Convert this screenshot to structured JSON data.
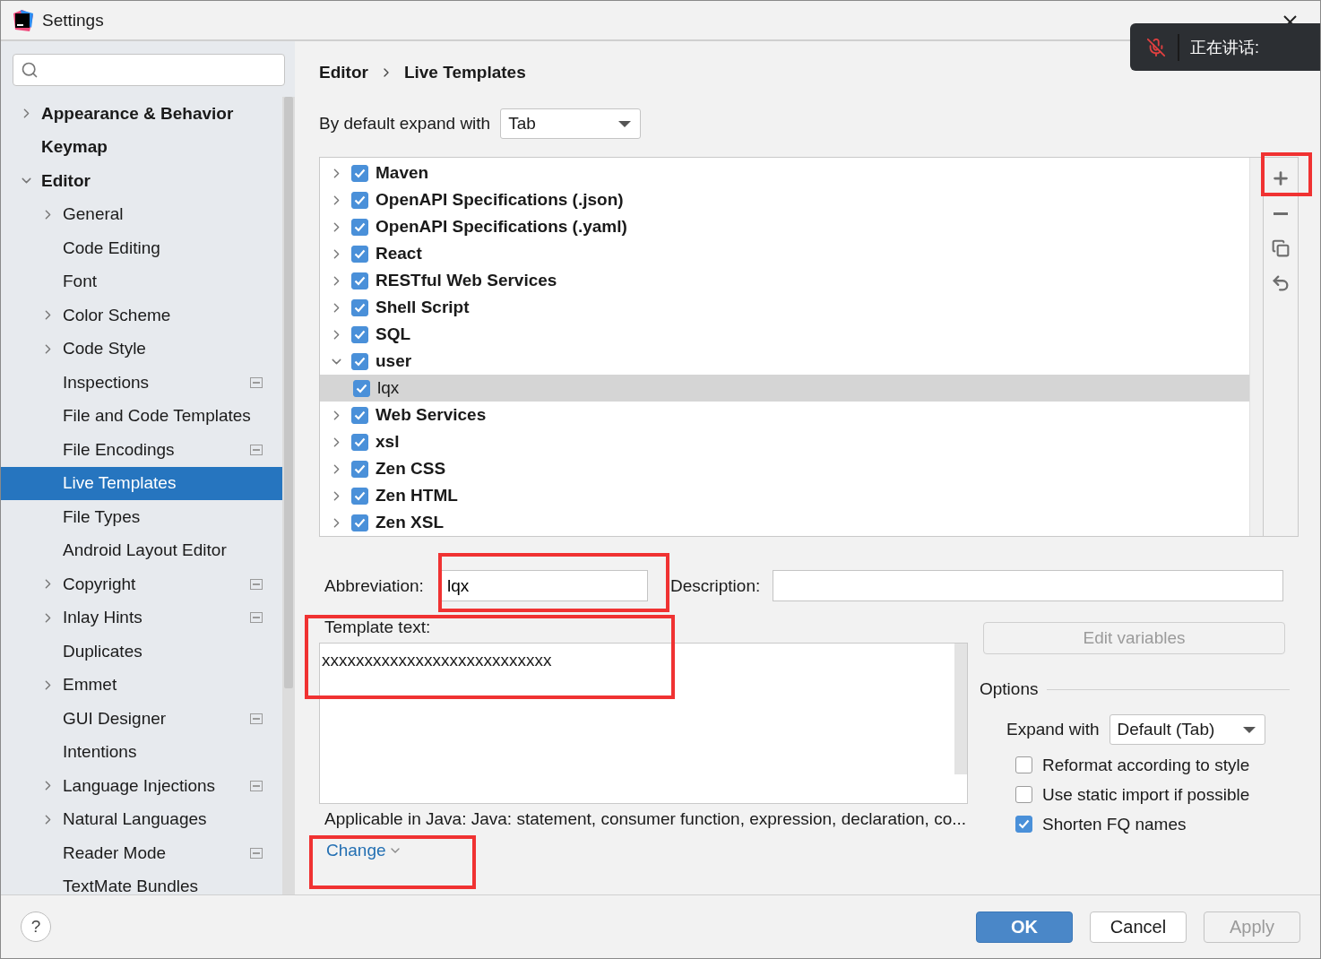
{
  "window": {
    "title": "Settings"
  },
  "sidebar": {
    "items": [
      {
        "label": "Appearance & Behavior",
        "expanded": false,
        "selected": false,
        "scoped": false
      },
      {
        "label": "Keymap",
        "selected": false,
        "scoped": false
      },
      {
        "label": "Editor",
        "expanded": true,
        "selected": false,
        "scoped": false,
        "children": [
          {
            "label": "General",
            "expanded": false,
            "selected": false,
            "scoped": false
          },
          {
            "label": "Code Editing",
            "selected": false,
            "scoped": false
          },
          {
            "label": "Font",
            "selected": false,
            "scoped": false
          },
          {
            "label": "Color Scheme",
            "expanded": false,
            "selected": false,
            "scoped": false
          },
          {
            "label": "Code Style",
            "expanded": false,
            "selected": false,
            "scoped": false
          },
          {
            "label": "Inspections",
            "selected": false,
            "scoped": true
          },
          {
            "label": "File and Code Templates",
            "selected": false,
            "scoped": false
          },
          {
            "label": "File Encodings",
            "selected": false,
            "scoped": true
          },
          {
            "label": "Live Templates",
            "selected": true,
            "scoped": false
          },
          {
            "label": "File Types",
            "selected": false,
            "scoped": false
          },
          {
            "label": "Android Layout Editor",
            "selected": false,
            "scoped": false
          },
          {
            "label": "Copyright",
            "expanded": false,
            "selected": false,
            "scoped": true
          },
          {
            "label": "Inlay Hints",
            "expanded": false,
            "selected": false,
            "scoped": true
          },
          {
            "label": "Duplicates",
            "selected": false,
            "scoped": false
          },
          {
            "label": "Emmet",
            "expanded": false,
            "selected": false,
            "scoped": false
          },
          {
            "label": "GUI Designer",
            "selected": false,
            "scoped": true
          },
          {
            "label": "Intentions",
            "selected": false,
            "scoped": false
          },
          {
            "label": "Language Injections",
            "expanded": false,
            "selected": false,
            "scoped": true
          },
          {
            "label": "Natural Languages",
            "expanded": false,
            "selected": false,
            "scoped": false
          },
          {
            "label": "Reader Mode",
            "selected": false,
            "scoped": true
          },
          {
            "label": "TextMate Bundles",
            "selected": false,
            "scoped": false
          }
        ]
      }
    ]
  },
  "breadcrumb": [
    "Editor",
    "Live Templates"
  ],
  "expand_default": {
    "label": "By default expand with",
    "value": "Tab"
  },
  "template_groups": [
    {
      "label": "Maven",
      "checked": true,
      "expanded": false,
      "selected": false
    },
    {
      "label": "OpenAPI Specifications (.json)",
      "checked": true,
      "expanded": false,
      "selected": false
    },
    {
      "label": "OpenAPI Specifications (.yaml)",
      "checked": true,
      "expanded": false,
      "selected": false
    },
    {
      "label": "React",
      "checked": true,
      "expanded": false,
      "selected": false
    },
    {
      "label": "RESTful Web Services",
      "checked": true,
      "expanded": false,
      "selected": false
    },
    {
      "label": "Shell Script",
      "checked": true,
      "expanded": false,
      "selected": false
    },
    {
      "label": "SQL",
      "checked": true,
      "expanded": false,
      "selected": false
    },
    {
      "label": "user",
      "checked": true,
      "expanded": true,
      "selected": false,
      "children": [
        {
          "label": "lqx",
          "checked": true,
          "selected": true
        }
      ]
    },
    {
      "label": "Web Services",
      "checked": true,
      "expanded": false,
      "selected": false
    },
    {
      "label": "xsl",
      "checked": true,
      "expanded": false,
      "selected": false
    },
    {
      "label": "Zen CSS",
      "checked": true,
      "expanded": false,
      "selected": false
    },
    {
      "label": "Zen HTML",
      "checked": true,
      "expanded": false,
      "selected": false
    },
    {
      "label": "Zen XSL",
      "checked": true,
      "expanded": false,
      "selected": false
    }
  ],
  "abbreviation": {
    "label": "Abbreviation:",
    "value": "lqx"
  },
  "description": {
    "label": "Description:"
  },
  "template_text": {
    "label": "Template text:",
    "value": "xxxxxxxxxxxxxxxxxxxxxxxxxxx"
  },
  "edit_variables": {
    "label": "Edit variables",
    "disabled": true
  },
  "options": {
    "title": "Options",
    "expand_with": {
      "label": "Expand with",
      "value": "Default (Tab)"
    },
    "checkboxes": [
      {
        "label": "Reformat according to style",
        "checked": false
      },
      {
        "label": "Use static import if possible",
        "checked": false
      },
      {
        "label": "Shorten FQ names",
        "checked": true
      }
    ]
  },
  "applicable": "Applicable in Java: Java: statement, consumer function, expression, declaration, co...",
  "change_link": "Change",
  "help": "?",
  "buttons": [
    {
      "label": "OK",
      "kind": "primary",
      "disabled": false
    },
    {
      "label": "Cancel",
      "kind": "default",
      "disabled": false
    },
    {
      "label": "Apply",
      "kind": "default",
      "disabled": true
    }
  ],
  "toast": {
    "text": "正在讲话:",
    "muted": true
  }
}
